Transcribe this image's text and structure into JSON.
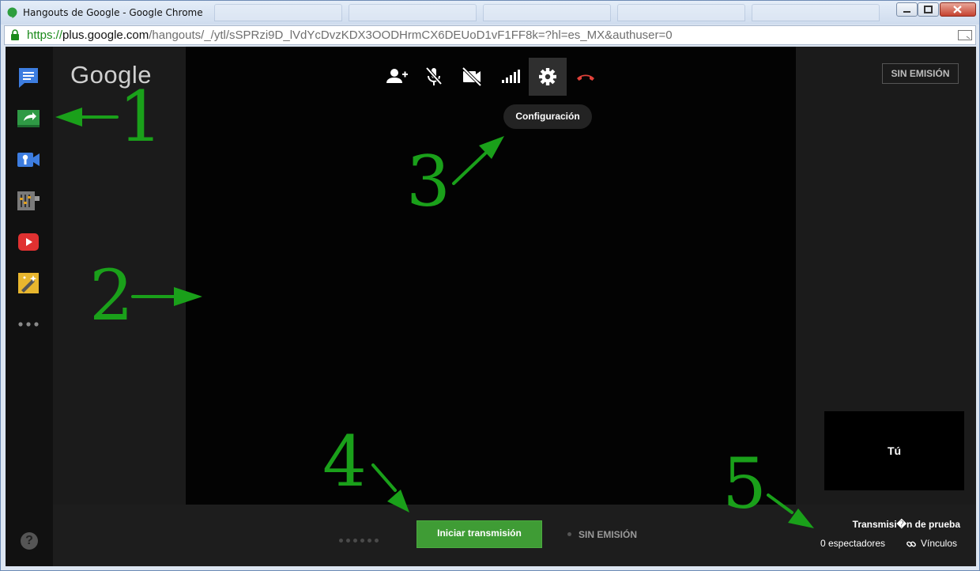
{
  "window": {
    "title": "Hangouts de Google - Google Chrome",
    "url_scheme": "https://",
    "url_host": "plus.google.com",
    "url_path": "/hangouts/_/ytl/sSPRzi9D_lVdYcDvzKDX3OODHrmCX6DEUoD1vF1FF8k=?hl=es_MX&authuser=0"
  },
  "app": {
    "logo": "Google",
    "rail": [
      {
        "icon": "chat-icon"
      },
      {
        "icon": "screenshare-icon"
      },
      {
        "icon": "camera-settings-icon"
      },
      {
        "icon": "control-room-icon"
      },
      {
        "icon": "youtube-icon"
      },
      {
        "icon": "effects-icon"
      },
      {
        "icon": "more-apps-icon"
      }
    ],
    "toolbar": [
      {
        "icon": "invite-people-icon"
      },
      {
        "icon": "mute-mic-icon"
      },
      {
        "icon": "camera-off-icon"
      },
      {
        "icon": "bandwidth-icon"
      },
      {
        "icon": "settings-icon"
      },
      {
        "icon": "hang-up-icon"
      }
    ],
    "tooltip": "Configuración",
    "top_status": "SIN EMISIÓN",
    "self_label": "Tú",
    "start_button": "Iniciar transmisión",
    "bottom_status": "SIN EMISIÓN",
    "broadcast_name": "Transmisi�n de prueba",
    "viewers": "0 espectadores",
    "links": "Vínculos",
    "help": "?"
  },
  "annotations": [
    "1",
    "2",
    "3",
    "4",
    "5"
  ],
  "colors": {
    "annotation": "#1aa01a",
    "start_button": "#3f9c35",
    "hangup": "#e0413a"
  }
}
